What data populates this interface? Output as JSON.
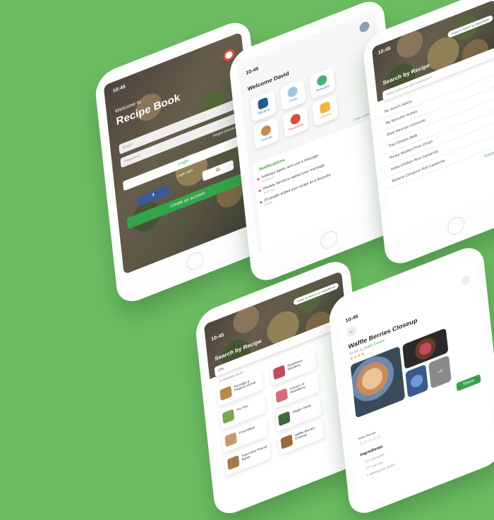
{
  "login": {
    "time": "10:45",
    "welcome": "Welcome to",
    "title": "Recipe Book",
    "email_placeholder": "Email",
    "password_placeholder": "Password",
    "forgot": "Forgot password?",
    "login_btn": "Login",
    "login_with": "Login with",
    "facebook": "f",
    "google": "G",
    "create_btn": "Create an account"
  },
  "welcome": {
    "time": "10:45",
    "greeting": "Welcome David",
    "tiles": [
      "Recipes",
      "Chats",
      "Networks",
      "Friends",
      "Favourites",
      "Uploads"
    ],
    "clear": "Clear notifications",
    "notif_title": "Notifications",
    "notifications": [
      {
        "text": "Adebayo Ajanlu sent you a message",
        "time": "Yesterday"
      },
      {
        "text": "Oladele TemSure replied your message",
        "time": "Just now"
      },
      {
        "text": "20 people added your recipe as a favourite",
        "time": "Earlier"
      }
    ]
  },
  "search1": {
    "time": "10:45",
    "swipe": "Swipe to search by ingredients",
    "title": "Search by Recipe",
    "placeholder": "What recipe are you looking for?",
    "rows": [
      "My search history",
      "My favourite recipes",
      "Easy Mexican Casserole",
      "Thai Chicken Balls",
      "Honey Mustard Pork Chops",
      "Salsa Chicken Rice Casserole",
      "Banana Cinnamon Roll Casserole"
    ],
    "explore": "Explore more"
  },
  "search2": {
    "time": "10:45",
    "swipe": "Swipe to search by ingredients",
    "title": "Search by Recipe",
    "query": "Chi",
    "found": "16 Recipes found",
    "cards": [
      "Sausage & Peppers Group",
      "Strawberry Wonders",
      "Pro Tins",
      "Colours of Strawberry",
      "Food Ways",
      "Veggie Gang",
      "Toast With Peanut Butter",
      "Waffle Berries Closeup"
    ]
  },
  "detail": {
    "time": "10:45",
    "title": "Waffle Berries Closeup",
    "recipe_by": "Recipe by",
    "author": "Dublin Daniels",
    "stars": "★★★★",
    "more": "+4",
    "share": "Share",
    "rate_label": "Rate Recipe",
    "rate_stars": "☆☆☆☆☆",
    "ingredients_title": "Ingredients",
    "ingredients": [
      "1/2 cup butter",
      "1/2 cup oats",
      "1 tablespoons butter"
    ]
  },
  "colors": {
    "background": "#6cbd62",
    "accent": "#35a34a"
  }
}
